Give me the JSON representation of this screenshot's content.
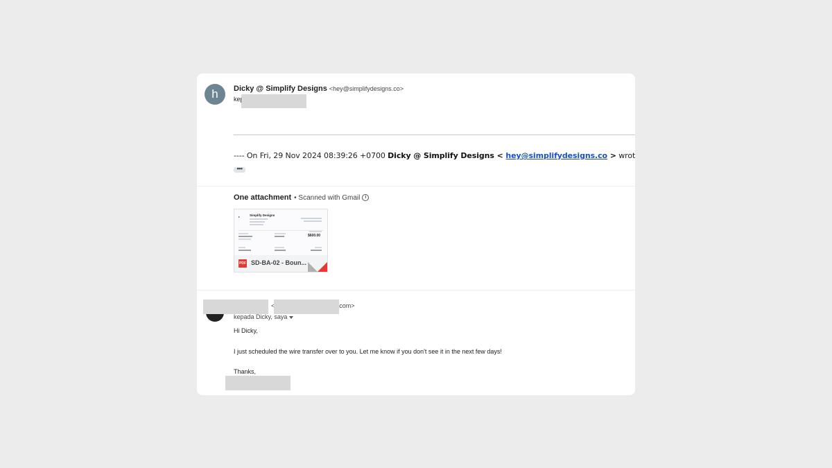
{
  "message1": {
    "avatar_initial": "h",
    "sender_name": "Dicky @ Simplify Designs",
    "sender_email": "<hey@simplifydesigns.co>",
    "to_prefix": "kepada",
    "quote": {
      "prefix": "---- On Fri, 29 Nov 2024 08:39:26 +0700 ",
      "name": "Dicky @ Simplify Designs",
      "open": " < ",
      "email": "hey@simplifydesigns.co",
      "suffix": " > wrote ---"
    },
    "expand_label": "•••"
  },
  "attachments": {
    "heading": "One attachment",
    "scan_note": "• Scanned with Gmail",
    "info_icon": "i",
    "file": {
      "name": "SD-BA-02 - Boun...",
      "type_label": "PDF",
      "preview": {
        "company": "Simplify Designs",
        "amount": "$600.00"
      }
    }
  },
  "message2": {
    "email_suffix": "s.com>",
    "email_open": "<",
    "recipients": "kepada Dicky, saya",
    "greeting": "Hi Dicky,",
    "body": "I just scheduled the wire transfer over to you. Let me know if you don't see it in the next few days!",
    "signoff": "Thanks,"
  },
  "colors": {
    "background": "#ececec",
    "card": "#ffffff",
    "avatar": "#6d8593",
    "link": "#1a4fbf",
    "pdf_red": "#e53935",
    "redaction": "#d8d8d8"
  }
}
